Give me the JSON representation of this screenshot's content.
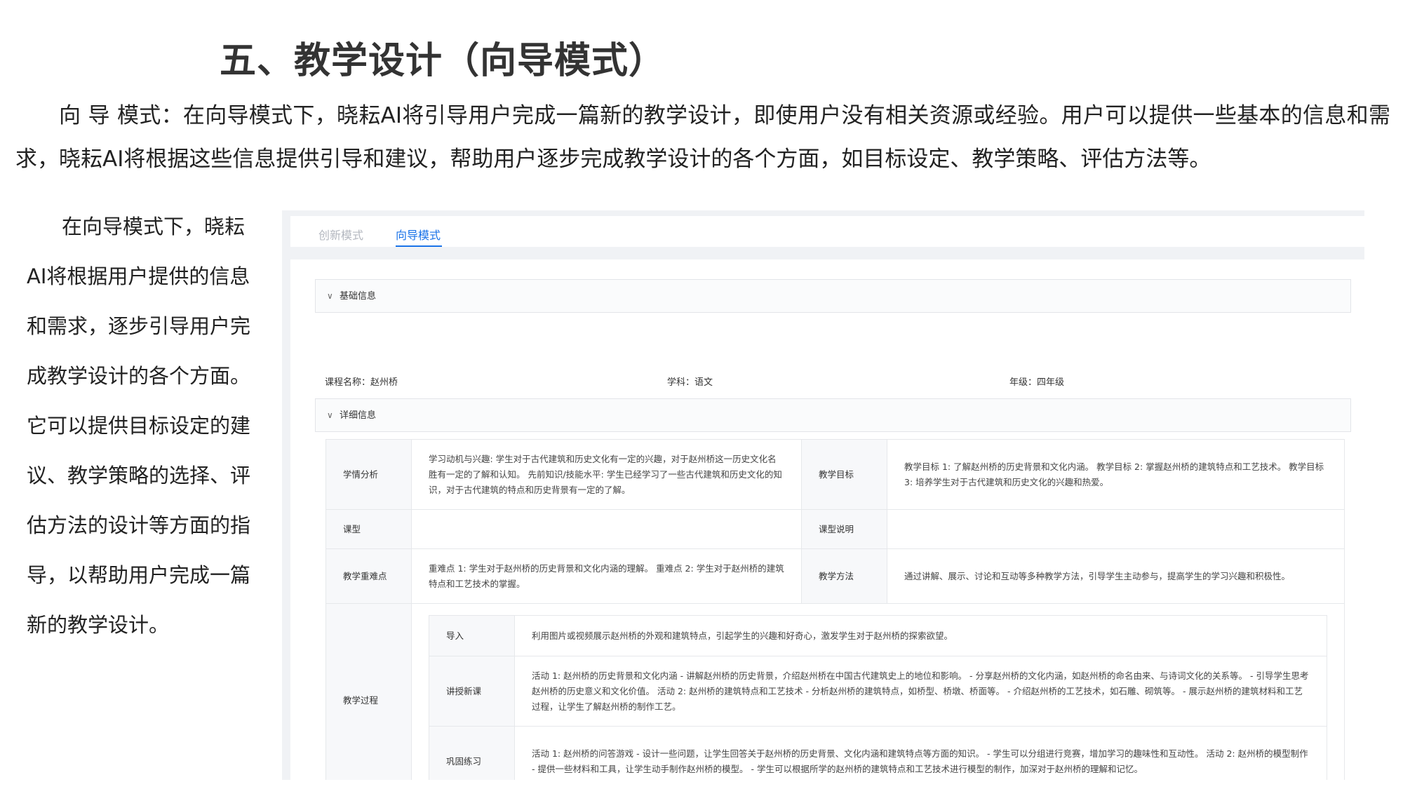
{
  "heading": "五、教学设计（向导模式）",
  "intro": "向 导 模式：在向导模式下，晓耘AI将引导用户完成一篇新的教学设计，即使用户没有相关资源或经验。用户可以提供一些基本的信息和需求，晓耘AI将根据这些信息提供引导和建议，帮助用户逐步完成教学设计的各个方面，如目标设定、教学策略、评估方法等。",
  "side_text": "在向导模式下，晓耘AI将根据用户提供的信息和需求，逐步引导用户完成教学设计的各个方面。它可以提供目标设定的建议、教学策略的选择、评估方法的设计等方面的指导，以帮助用户完成一篇新的教学设计。",
  "app": {
    "tabs": [
      "创新模式",
      "向导模式"
    ],
    "active_tab": "向导模式",
    "basic_section": "基础信息",
    "detail_section": "详细信息",
    "basic": {
      "course": "课程名称：赵州桥",
      "subject": "学科：语文",
      "grade": "年级：四年级"
    },
    "detail": {
      "xueqing_label": "学情分析",
      "xueqing": "学习动机与兴趣: 学生对于古代建筑和历史文化有一定的兴趣，对于赵州桥这一历史文化名胜有一定的了解和认知。 先前知识/技能水平: 学生已经学习了一些古代建筑和历史文化的知识，对于古代建筑的特点和历史背景有一定的了解。",
      "goal_label": "教学目标",
      "goal": "教学目标 1: 了解赵州桥的历史背景和文化内涵。 教学目标 2: 掌握赵州桥的建筑特点和工艺技术。 教学目标 3: 培养学生对于古代建筑和历史文化的兴趣和热爱。",
      "type_label": "课型",
      "type": "",
      "type_desc_label": "课型说明",
      "type_desc": "",
      "key_label": "教学重难点",
      "key": "重难点 1: 学生对于赵州桥的历史背景和文化内涵的理解。 重难点 2: 学生对于赵州桥的建筑特点和工艺技术的掌握。",
      "method_label": "教学方法",
      "method": "通过讲解、展示、讨论和互动等多种教学方法，引导学生主动参与，提高学生的学习兴趣和积极性。",
      "process_label": "教学过程",
      "process": [
        {
          "label": "导入",
          "text": "利用图片或视频展示赵州桥的外观和建筑特点，引起学生的兴趣和好奇心，激发学生对于赵州桥的探索欲望。"
        },
        {
          "label": "讲授新课",
          "text": "活动 1: 赵州桥的历史背景和文化内涵 - 讲解赵州桥的历史背景，介绍赵州桥在中国古代建筑史上的地位和影响。 - 分享赵州桥的文化内涵，如赵州桥的命名由来、与诗词文化的关系等。 - 引导学生思考赵州桥的历史意义和文化价值。 活动 2: 赵州桥的建筑特点和工艺技术 - 分析赵州桥的建筑特点，如桥型、桥墩、桥面等。 - 介绍赵州桥的工艺技术，如石雕、砌筑等。 - 展示赵州桥的建筑材料和工艺过程，让学生了解赵州桥的制作工艺。"
        },
        {
          "label": "巩固练习",
          "text": "活动 1: 赵州桥的问答游戏 - 设计一些问题，让学生回答关于赵州桥的历史背景、文化内涵和建筑特点等方面的知识。 - 学生可以分组进行竞赛，增加学习的趣味性和互动性。 活动 2: 赵州桥的模型制作 - 提供一些材料和工具，让学生动手制作赵州桥的模型。 - 学生可以根据所学的赵州桥的建筑特点和工艺技术进行模型的制作，加深对于赵州桥的理解和记忆。"
        }
      ]
    }
  }
}
